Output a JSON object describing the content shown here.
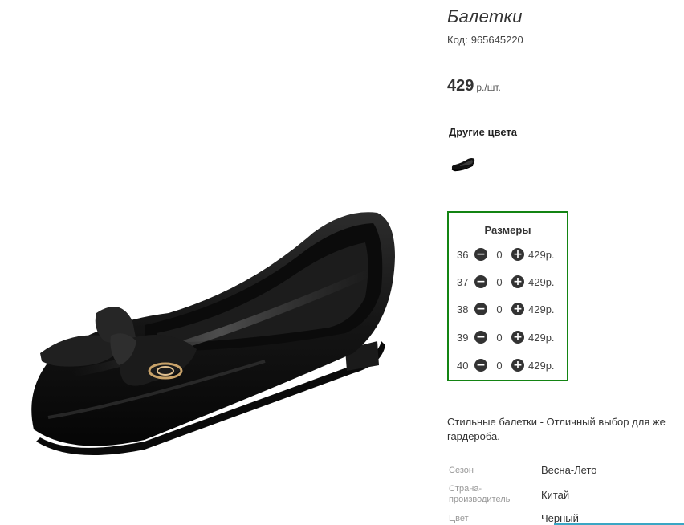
{
  "product": {
    "title": "Балетки",
    "code_label": "Код:",
    "code_value": "965645220",
    "price_amount": "429",
    "price_unit": "р./шт.",
    "image_icon": "ballet-flat-shoe-photo"
  },
  "other_colors": {
    "title": "Другие цвета",
    "swatch_icon": "black-ballet-flat-thumbnail"
  },
  "sizes": {
    "title": "Размеры",
    "border_color": "#138413",
    "minus_icon": "minus-circle-icon",
    "plus_icon": "plus-circle-icon",
    "rows": [
      {
        "size": "36",
        "qty": "0",
        "price": "429р."
      },
      {
        "size": "37",
        "qty": "0",
        "price": "429р."
      },
      {
        "size": "38",
        "qty": "0",
        "price": "429р."
      },
      {
        "size": "39",
        "qty": "0",
        "price": "429р."
      },
      {
        "size": "40",
        "qty": "0",
        "price": "429р."
      }
    ]
  },
  "description": {
    "line1": "Стильные балетки - Отличный выбор для же",
    "line2": "гардероба."
  },
  "properties": [
    {
      "label": "Сезон",
      "value": "Весна-Лето"
    },
    {
      "label": "Страна-производитель",
      "label_line1": "Страна-",
      "label_line2": "производитель",
      "value": "Китай"
    },
    {
      "label": "Цвет",
      "value": "Чёрный"
    }
  ]
}
